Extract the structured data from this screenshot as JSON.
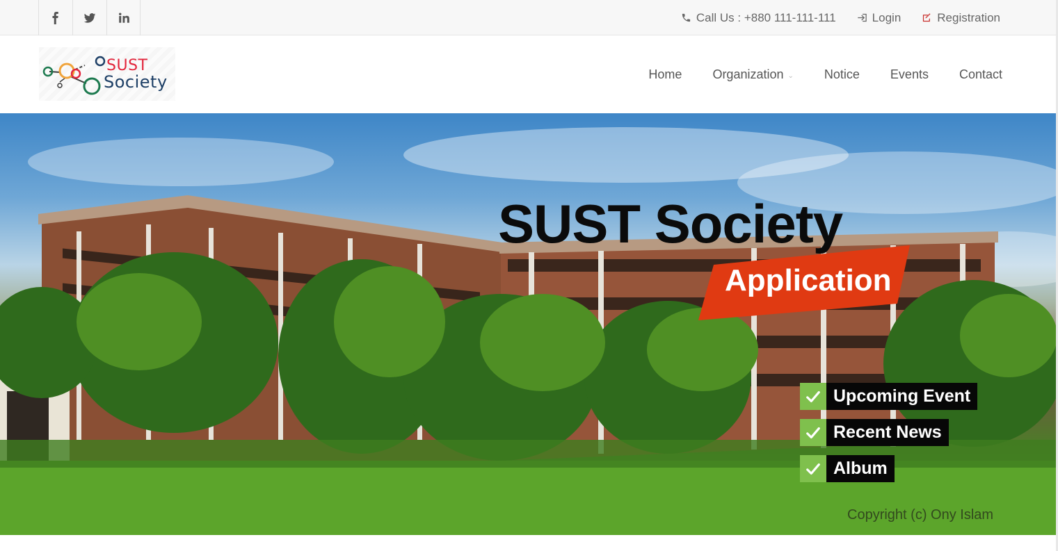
{
  "topbar": {
    "social": [
      {
        "name": "facebook",
        "icon": "facebook-icon"
      },
      {
        "name": "twitter",
        "icon": "twitter-icon"
      },
      {
        "name": "linkedin",
        "icon": "linkedin-icon"
      }
    ],
    "call_label": "Call Us : +880 111-111-111",
    "login_label": "Login",
    "registration_label": "Registration"
  },
  "header": {
    "logo_line1": "SUST",
    "logo_line2": "Society",
    "nav": [
      "Home",
      "Organization",
      "Notice",
      "Events",
      "Contact"
    ]
  },
  "hero": {
    "title": "SUST Society",
    "badge": "Application",
    "items": [
      "Upcoming Event",
      "Recent News",
      "Album"
    ],
    "copyright": "Copyright (c) Ony Islam"
  },
  "colors": {
    "accent_red": "#e03a12",
    "check_green": "#7fc04d",
    "registration_icon": "#c9302c"
  }
}
